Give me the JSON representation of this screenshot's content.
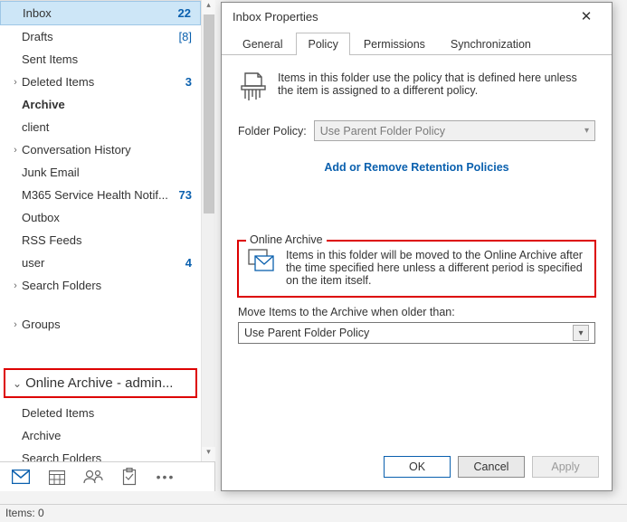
{
  "sidebar": {
    "folders": [
      {
        "name": "Inbox",
        "count": "22",
        "selected": true,
        "hasChevron": false,
        "indent": true
      },
      {
        "name": "Drafts",
        "count": "[8]",
        "bracket": true,
        "indent": true
      },
      {
        "name": "Sent Items",
        "indent": true
      },
      {
        "name": "Deleted Items",
        "count": "3",
        "hasChevron": true,
        "chevron": "›"
      },
      {
        "name": "Archive",
        "bold": true,
        "indent": true
      },
      {
        "name": "client",
        "indent": true
      },
      {
        "name": "Conversation History",
        "hasChevron": true,
        "chevron": "›"
      },
      {
        "name": "Junk Email",
        "indent": true
      },
      {
        "name": "M365 Service Health Notif...",
        "count": "73",
        "indent": true
      },
      {
        "name": "Outbox",
        "indent": true
      },
      {
        "name": "RSS Feeds",
        "indent": true
      },
      {
        "name": "user",
        "count": "4",
        "indent": true
      },
      {
        "name": "Search Folders",
        "hasChevron": true,
        "chevron": "›"
      }
    ],
    "groups_label": "Groups",
    "account_label": "Online Archive - admin...",
    "archive_folders": [
      {
        "name": "Deleted Items"
      },
      {
        "name": "Archive"
      },
      {
        "name": "Search Folders"
      }
    ]
  },
  "nav": {
    "icons": [
      "mail-icon",
      "calendar-icon",
      "people-icon",
      "tasks-icon",
      "more-icon"
    ]
  },
  "status": {
    "items_label": "Items: 0"
  },
  "dialog": {
    "title": "Inbox Properties",
    "tabs": [
      "General",
      "Policy",
      "Permissions",
      "Synchronization"
    ],
    "active_tab": 1,
    "policy_desc": "Items in this folder use the policy that is defined here unless the item is assigned to a different policy.",
    "folder_policy_label": "Folder Policy:",
    "folder_policy_value": "Use Parent Folder Policy",
    "policy_link": "Add or Remove Retention Policies",
    "archive_legend": "Online Archive",
    "archive_desc": "Items in this folder will be moved to the Online Archive after the time specified here unless a different period is specified on the item itself.",
    "move_label": "Move Items to the Archive when older than:",
    "move_value": "Use Parent Folder Policy",
    "buttons": {
      "ok": "OK",
      "cancel": "Cancel",
      "apply": "Apply"
    }
  }
}
